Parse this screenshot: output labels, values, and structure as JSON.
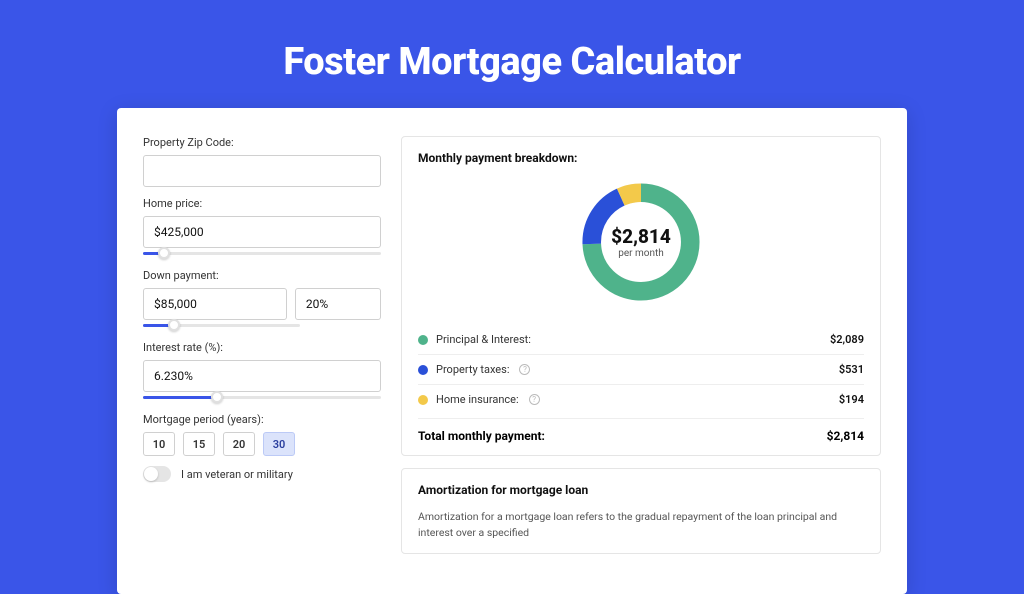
{
  "page": {
    "title": "Foster Mortgage Calculator"
  },
  "form": {
    "zip_label": "Property Zip Code:",
    "zip_value": "",
    "home_price_label": "Home price:",
    "home_price_value": "$425,000",
    "home_price_slider_pct": 9,
    "down_label": "Down payment:",
    "down_value": "$85,000",
    "down_pct": "20%",
    "down_slider_pct": 20,
    "rate_label": "Interest rate (%):",
    "rate_value": "6.230%",
    "rate_slider_pct": 31,
    "period_label": "Mortgage period (years):",
    "periods": [
      "10",
      "15",
      "20",
      "30"
    ],
    "period_selected": "30",
    "veteran_label": "I am veteran or military"
  },
  "breakdown": {
    "title": "Monthly payment breakdown:",
    "donut_amount": "$2,814",
    "donut_sub": "per month",
    "items": [
      {
        "color": "#4fb38b",
        "label": "Principal & Interest:",
        "value": "$2,089",
        "help": false
      },
      {
        "color": "#2a50d8",
        "label": "Property taxes:",
        "value": "$531",
        "help": true
      },
      {
        "color": "#f3c94a",
        "label": "Home insurance:",
        "value": "$194",
        "help": true
      }
    ],
    "total_label": "Total monthly payment:",
    "total_value": "$2,814"
  },
  "amort": {
    "title": "Amortization for mortgage loan",
    "text": "Amortization for a mortgage loan refers to the gradual repayment of the loan principal and interest over a specified"
  },
  "chart_data": {
    "type": "pie",
    "title": "Monthly payment breakdown",
    "series": [
      {
        "name": "Principal & Interest",
        "value": 2089,
        "color": "#4fb38b"
      },
      {
        "name": "Property taxes",
        "value": 531,
        "color": "#2a50d8"
      },
      {
        "name": "Home insurance",
        "value": 194,
        "color": "#f3c94a"
      }
    ],
    "total": 2814,
    "center_label": "$2,814 per month"
  }
}
